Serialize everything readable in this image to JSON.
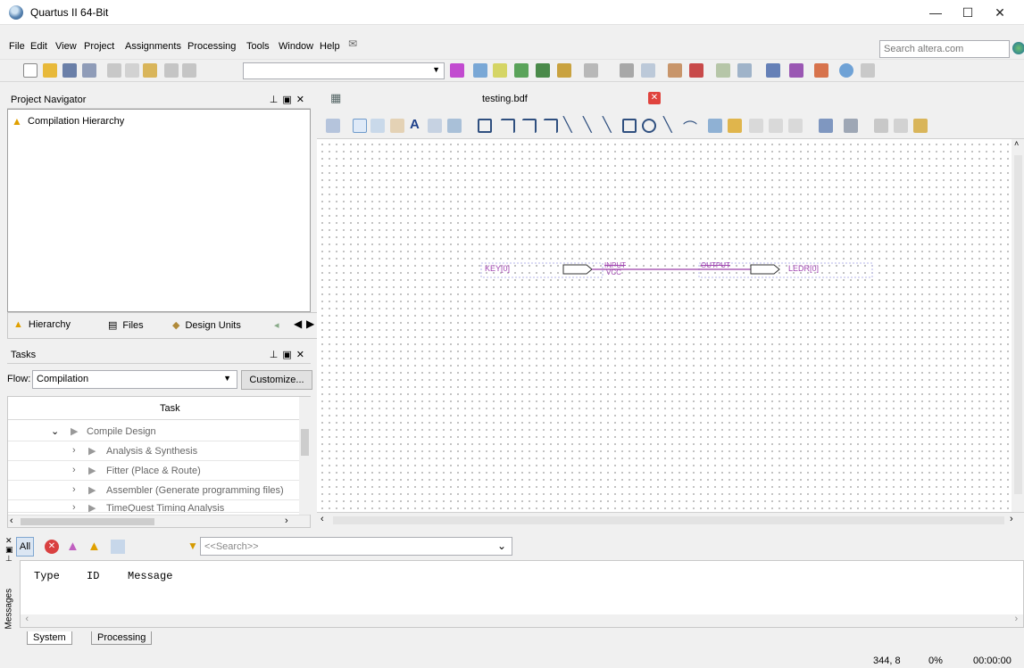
{
  "window": {
    "title": "Quartus II 64-Bit",
    "minimize": "—",
    "maximize": "☐",
    "close": "✕"
  },
  "menu": [
    "File",
    "Edit",
    "View",
    "Project",
    "Assignments",
    "Processing",
    "Tools",
    "Window",
    "Help"
  ],
  "search": {
    "placeholder": "Search altera.com"
  },
  "project_navigator": {
    "title": "Project Navigator",
    "item": "Compilation Hierarchy",
    "tabs": [
      "Hierarchy",
      "Files",
      "Design Units"
    ]
  },
  "tasks": {
    "title": "Tasks",
    "flow_label": "Flow:",
    "flow_value": "Compilation",
    "customize": "Customize...",
    "column": "Task",
    "rows": [
      "Compile Design",
      "Analysis & Synthesis",
      "Fitter (Place & Route)",
      "Assembler (Generate programming files)",
      "TimeQuest Timing Analysis"
    ]
  },
  "editor": {
    "tab": "testing.bdf",
    "schematic": {
      "input_pin": "KEY[0]",
      "input_type": "INPUT",
      "vcc": "VCC",
      "output_type": "OUTPUT",
      "output_pin": "LEDR[0]"
    }
  },
  "messages": {
    "all": "All",
    "search_placeholder": "<<Search>>",
    "columns": [
      "Type",
      "ID",
      "Message"
    ],
    "side_label": "Messages",
    "tabs": [
      "System",
      "Processing"
    ]
  },
  "status": {
    "coords": "344, 8",
    "progress": "0%",
    "time": "00:00:00"
  },
  "colors": {
    "schematic_wire": "#9b3fa6",
    "pin_text": "#a044b0"
  }
}
